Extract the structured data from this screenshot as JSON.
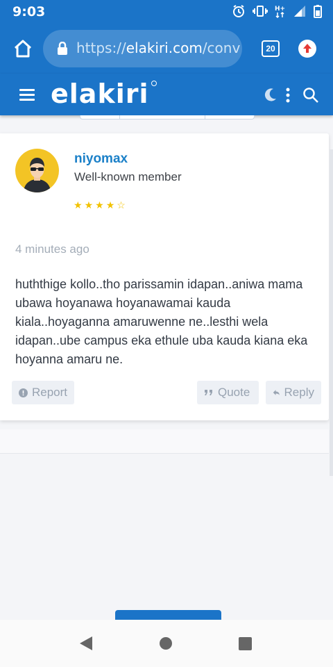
{
  "status_bar": {
    "time": "9:03"
  },
  "browser": {
    "url_scheme": "https://",
    "url_host": "elakiri.com",
    "url_path": "/conv",
    "tab_count": "20"
  },
  "header": {
    "logo": "elakiri"
  },
  "post": {
    "username": "niyomax",
    "user_title": "Well-known member",
    "rating_stars": 4.5,
    "time": "4 minutes ago",
    "body": "huththige kollo..tho parissamin idapan..aniwa mama ubawa hoyanawa hoyanawamai kauda kiala..hoyaganna amaruwenne ne..lesthi wela idapan..ube campus eka ethule uba kauda kiana eka hoyanna amaru ne.",
    "actions": {
      "report": "Report",
      "quote": "Quote",
      "reply": "Reply"
    }
  },
  "colors": {
    "primary": "#1b74c8",
    "username": "#1b80c8",
    "star": "#f2c200",
    "avatar_bg": "#f3c425"
  }
}
